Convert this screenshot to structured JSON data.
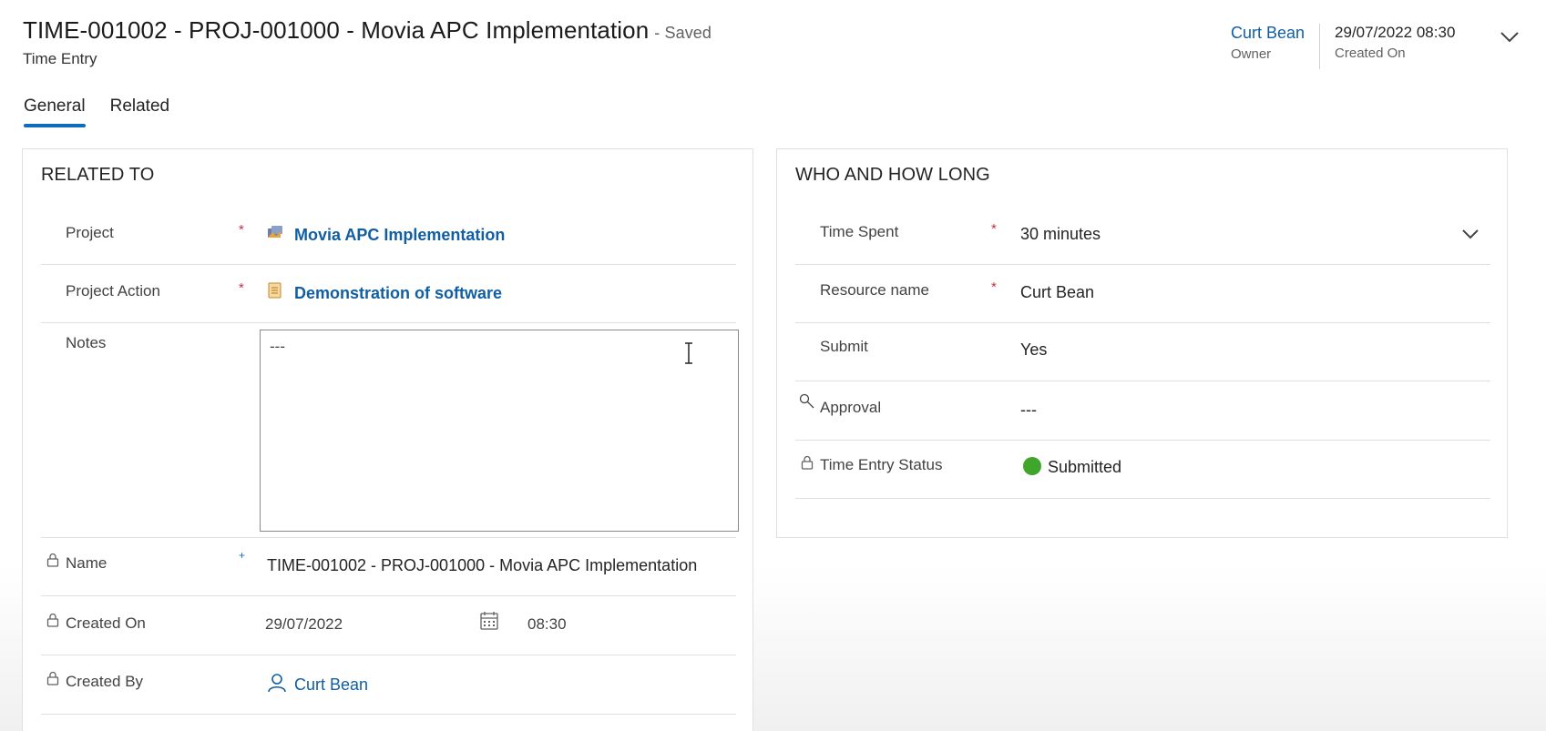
{
  "header": {
    "title": "TIME-001002 - PROJ-001000 - Movia APC Implementation",
    "save_status": "- Saved",
    "entity": "Time Entry",
    "owner_value": "Curt Bean",
    "owner_label": "Owner",
    "created_on_value": "29/07/2022 08:30",
    "created_on_label": "Created On"
  },
  "tabs": [
    {
      "label": "General"
    },
    {
      "label": "Related"
    }
  ],
  "related_to": {
    "title": "RELATED TO",
    "project_label": "Project",
    "project_value": "Movia APC Implementation",
    "project_action_label": "Project Action",
    "project_action_value": "Demonstration of software",
    "notes_label": "Notes",
    "notes_value": "---",
    "name_label": "Name",
    "name_value": "TIME-001002 - PROJ-001000 - Movia APC Implementation",
    "created_on_label": "Created On",
    "created_on_date": "29/07/2022",
    "created_on_time": "08:30",
    "created_by_label": "Created By",
    "created_by_value": "Curt Bean",
    "required_mark": "*",
    "recommended_mark": "+"
  },
  "who_how_long": {
    "title": "WHO AND HOW LONG",
    "time_spent_label": "Time Spent",
    "time_spent_value": "30 minutes",
    "resource_label": "Resource name",
    "resource_value": "Curt Bean",
    "submit_label": "Submit",
    "submit_value": "Yes",
    "approval_label": "Approval",
    "approval_value": "---",
    "status_label": "Time Entry Status",
    "status_value": "Submitted",
    "required_mark": "*"
  },
  "colors": {
    "accent": "#0f6cbd",
    "link": "#115ea3",
    "required": "#c4314b",
    "status_submitted": "#3fa52b"
  },
  "icons": {
    "project": "project-icon",
    "project_action": "project-action-icon",
    "lock": "lock-icon",
    "search": "search-key-icon",
    "calendar": "calendar-icon",
    "person": "person-icon",
    "chevron": "chevron-down-icon",
    "text_cursor": "text-cursor-icon"
  }
}
